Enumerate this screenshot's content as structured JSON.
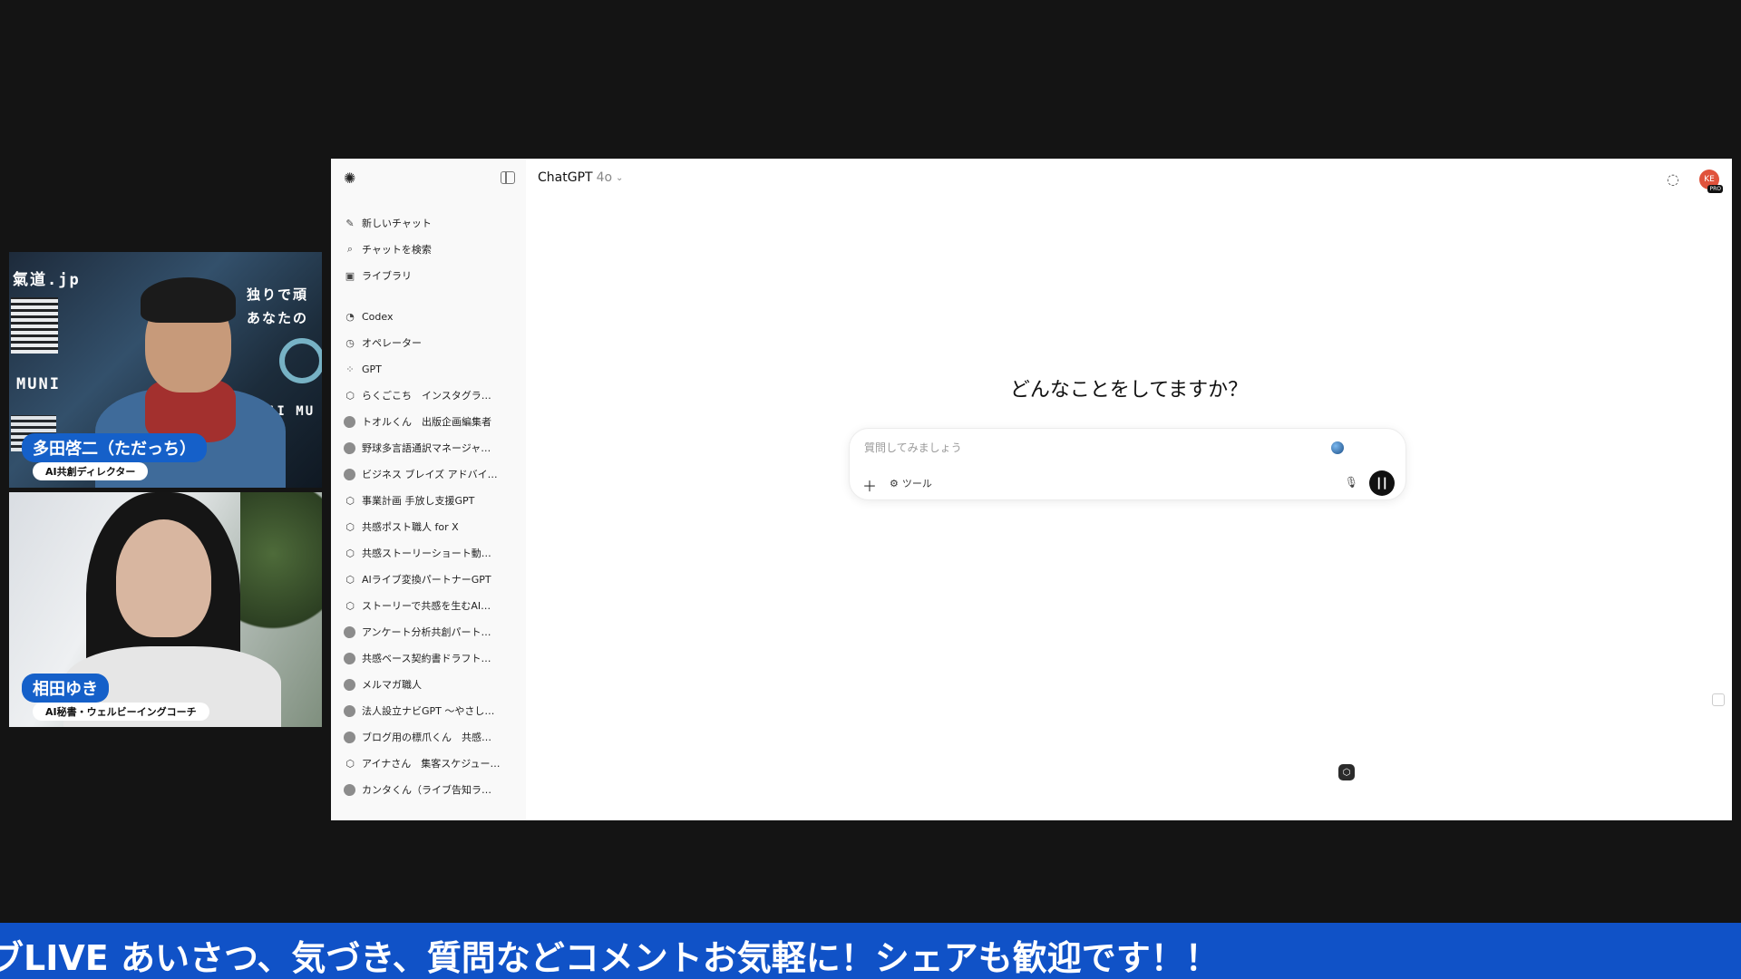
{
  "cams": {
    "top": {
      "brand": "氣道.jp",
      "side_text_1": "独りで頑",
      "side_text_2": "あなたの",
      "muni": "MUNI",
      "ai_mu": "AI MU",
      "name": "多田啓二（ただっち）",
      "role": "AI共創ディレクター"
    },
    "bottom": {
      "name": "相田ゆき",
      "role": "AI秘書・ウェルビーイングコーチ"
    }
  },
  "app": {
    "title": "ChatGPT",
    "model": "4o",
    "heading": "どんなことをしてますか？",
    "composer": {
      "placeholder": "質問してみましょう",
      "tools_label": "ツール"
    },
    "avatar_initials": "KE",
    "avatar_badge": "PRO"
  },
  "sidebar": {
    "primary": [
      {
        "label": "新しいチャット",
        "icon": "edit-icon"
      },
      {
        "label": "チャットを検索",
        "icon": "search-icon"
      },
      {
        "label": "ライブラリ",
        "icon": "library-icon"
      }
    ],
    "tools": [
      {
        "label": "Codex",
        "icon": "codex-icon"
      },
      {
        "label": "オペレーター",
        "icon": "operator-icon"
      },
      {
        "label": "GPT",
        "icon": "grid-icon"
      }
    ],
    "gpts": [
      {
        "label": "らくごこち　インスタグラ…",
        "type": "cube"
      },
      {
        "label": "トオルくん　出版企画編集者",
        "type": "avatar"
      },
      {
        "label": "野球多言語通訳マネージャ…",
        "type": "avatar"
      },
      {
        "label": "ビジネス ブレイズ アドバイ…",
        "type": "avatar"
      },
      {
        "label": "事業計画 手放し支援GPT",
        "type": "cube"
      },
      {
        "label": "共感ポスト職人 for X",
        "type": "cube"
      },
      {
        "label": "共感ストーリーショート動…",
        "type": "cube"
      },
      {
        "label": "AIライブ変換パートナーGPT",
        "type": "cube"
      },
      {
        "label": "ストーリーで共感を生むAI…",
        "type": "cube"
      },
      {
        "label": "アンケート分析共創パート…",
        "type": "avatar"
      },
      {
        "label": "共感ベース契約書ドラフト…",
        "type": "avatar"
      },
      {
        "label": "メルマガ職人",
        "type": "avatar"
      },
      {
        "label": "法人設立ナビGPT ～やさし…",
        "type": "avatar"
      },
      {
        "label": "ブログ用の標爪くん　共感…",
        "type": "avatar"
      },
      {
        "label": "アイナさん　集客スケジュー…",
        "type": "cube"
      },
      {
        "label": "カンタくん（ライブ告知ラ…",
        "type": "avatar"
      }
    ]
  },
  "ticker": {
    "text": "ブLIVE あいさつ、気づき、質問などコメントお気軽に！シェアも歓迎です！！"
  }
}
